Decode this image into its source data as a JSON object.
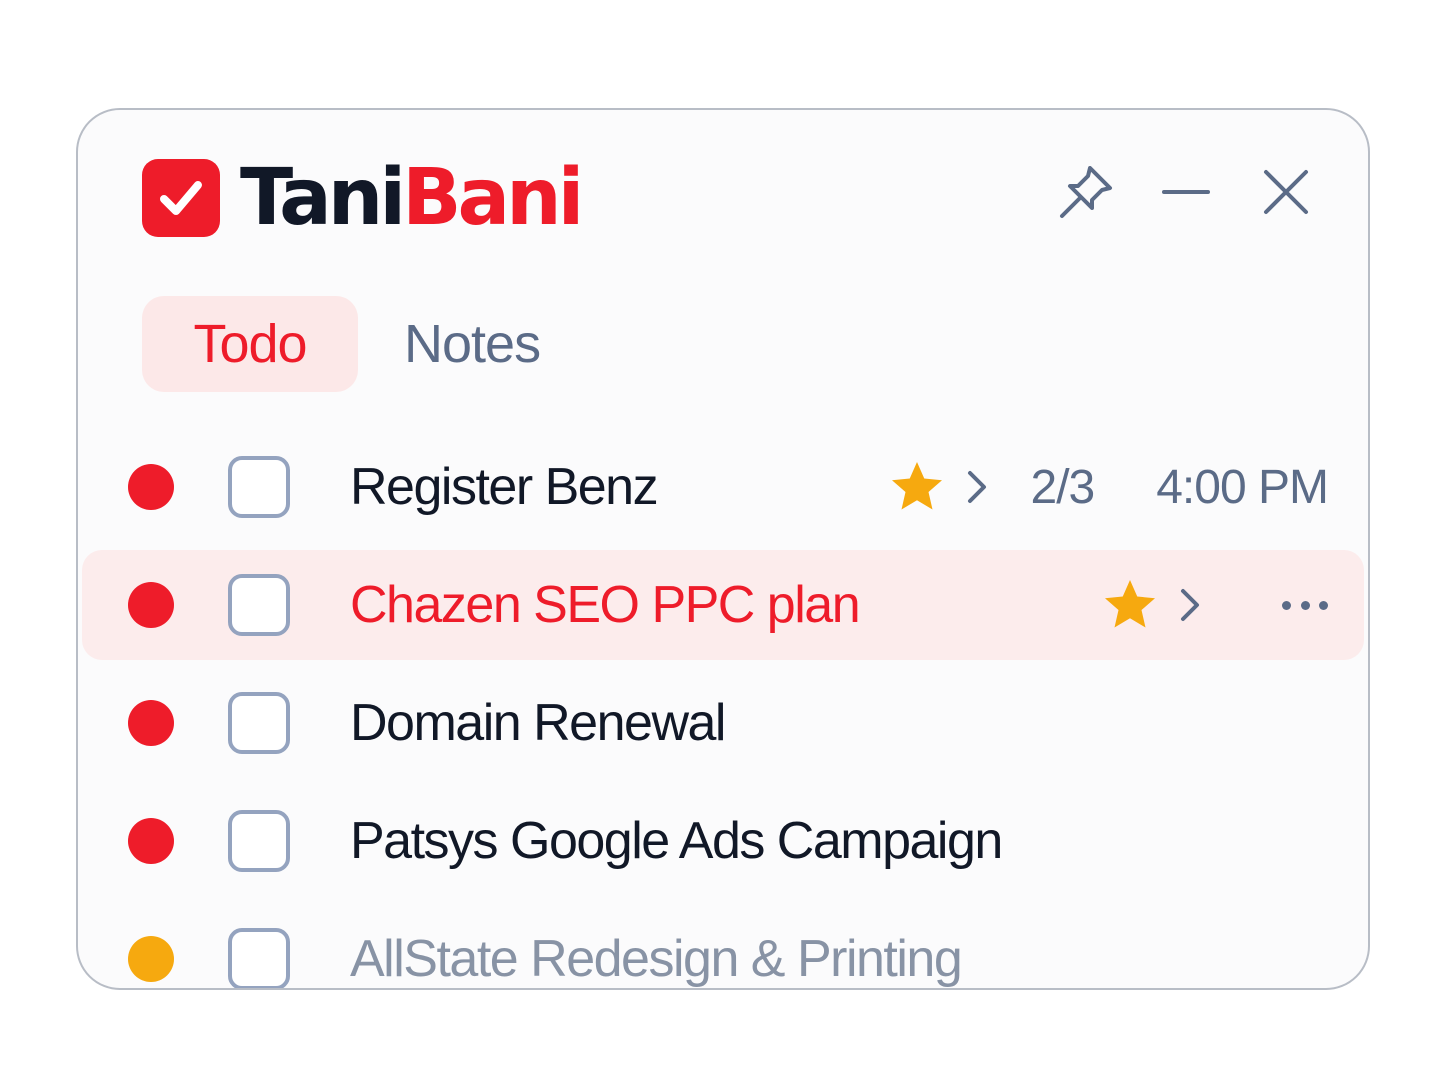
{
  "app": {
    "name_part1": "Tani",
    "name_part2": "Bani",
    "logo_icon": "checkbox-checked-icon"
  },
  "window_controls": [
    {
      "name": "pin",
      "icon": "pin-icon"
    },
    {
      "name": "minimize",
      "icon": "minimize-icon"
    },
    {
      "name": "close",
      "icon": "close-icon"
    }
  ],
  "tabs": [
    {
      "label": "Todo",
      "active": true
    },
    {
      "label": "Notes",
      "active": false
    }
  ],
  "tasks": [
    {
      "title": "Register Benz",
      "priority_color": "#ee1c2a",
      "starred": true,
      "subtasks": "2/3",
      "time": "4:00 PM",
      "highlighted": false
    },
    {
      "title": "Chazen SEO PPC plan",
      "priority_color": "#ee1c2a",
      "starred": true,
      "highlighted": true,
      "more_icon": "more-horizontal-icon"
    },
    {
      "title": "Domain Renewal",
      "priority_color": "#ee1c2a",
      "starred": false,
      "highlighted": false
    },
    {
      "title": "Patsys Google Ads Campaign",
      "priority_color": "#ee1c2a",
      "starred": false,
      "highlighted": false
    },
    {
      "title": "AllState Redesign & Printing",
      "priority_color": "#f6a90f",
      "starred": false,
      "highlighted": false
    }
  ],
  "colors": {
    "brand_red": "#ee1c2a",
    "star": "#f6a90f",
    "muted": "#5b6b87",
    "highlight_bg": "#fcecec"
  }
}
